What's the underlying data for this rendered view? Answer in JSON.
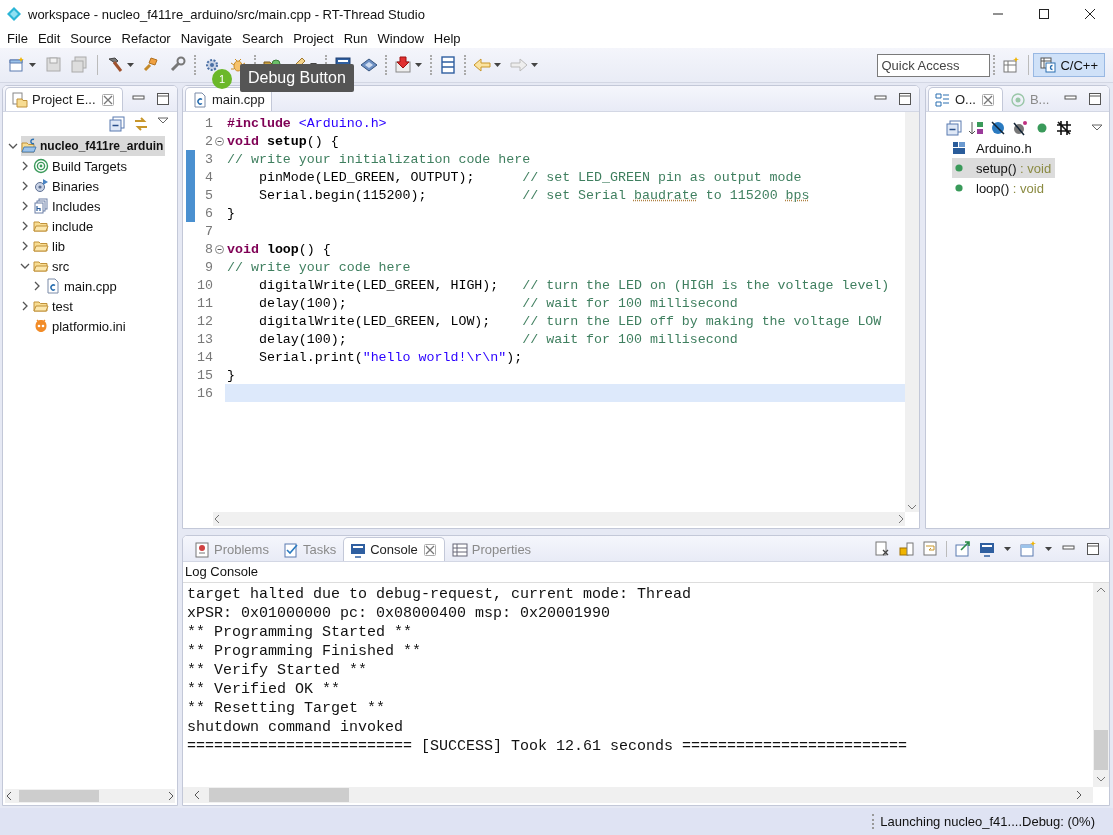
{
  "window": {
    "title": "workspace - nucleo_f411re_arduino/src/main.cpp - RT-Thread Studio"
  },
  "menu": [
    "File",
    "Edit",
    "Source",
    "Refactor",
    "Navigate",
    "Search",
    "Project",
    "Run",
    "Window",
    "Help"
  ],
  "toolbar": {
    "tooltip": {
      "badge": "1",
      "text": "Debug Button"
    },
    "quick_access": {
      "placeholder": "Quick Access"
    },
    "perspective": {
      "label": "C/C++",
      "selected": true
    }
  },
  "project_explorer": {
    "tabs": [
      {
        "label": "Project E...",
        "selected": true
      }
    ],
    "tree": [
      {
        "label": "nucleo_f411re_arduin",
        "kind": "project",
        "expanded": true,
        "selected": true,
        "children": [
          {
            "label": "Build Targets",
            "kind": "targets",
            "expanded": false,
            "selected": false
          },
          {
            "label": "Binaries",
            "kind": "binaries",
            "expanded": false,
            "selected": false
          },
          {
            "label": "Includes",
            "kind": "includes",
            "expanded": false,
            "selected": false
          },
          {
            "label": "include",
            "kind": "folder",
            "expanded": false,
            "selected": false
          },
          {
            "label": "lib",
            "kind": "folder",
            "expanded": false,
            "selected": false
          },
          {
            "label": "src",
            "kind": "folder",
            "expanded": true,
            "selected": false,
            "children": [
              {
                "label": "main.cpp",
                "kind": "source",
                "expanded": false,
                "selected": false
              }
            ]
          },
          {
            "label": "test",
            "kind": "folder",
            "expanded": false,
            "selected": false
          },
          {
            "label": "platformio.ini",
            "kind": "config",
            "selected": false
          }
        ]
      }
    ]
  },
  "editor": {
    "tabs": [
      {
        "label": "main.cpp",
        "selected": true
      }
    ],
    "lines": [
      {
        "number": "1",
        "changed": false,
        "current": false,
        "foldable": false,
        "segments": [
          {
            "kind": "preprocessor",
            "text": "#include "
          },
          {
            "kind": "string",
            "text": "<Arduino.h>"
          }
        ]
      },
      {
        "number": "2",
        "changed": false,
        "current": false,
        "foldable": true,
        "segments": [
          {
            "kind": "keyword",
            "text": "void "
          },
          {
            "kind": "function",
            "text": "setup"
          },
          {
            "kind": "plain",
            "text": "() {"
          }
        ]
      },
      {
        "number": "3",
        "changed": true,
        "current": false,
        "foldable": false,
        "segments": [
          {
            "kind": "comment",
            "text": "// write your initialization code here"
          }
        ]
      },
      {
        "number": "4",
        "changed": true,
        "current": false,
        "foldable": false,
        "segments": [
          {
            "kind": "plain",
            "text": "    pinMode(LED_GREEN, OUTPUT);      "
          },
          {
            "kind": "comment",
            "text": "// set LED_GREEN pin as output mode"
          }
        ]
      },
      {
        "number": "5",
        "changed": true,
        "current": false,
        "foldable": false,
        "segments": [
          {
            "kind": "plain",
            "text": "    Serial.begin(115200);            "
          },
          {
            "kind": "comment",
            "text": "// set Serial "
          },
          {
            "kind": "misspelled",
            "text": "baudrate"
          },
          {
            "kind": "comment",
            "text": " to 115200 "
          },
          {
            "kind": "misspelled",
            "text": "bps"
          }
        ]
      },
      {
        "number": "6",
        "changed": true,
        "current": false,
        "foldable": false,
        "segments": [
          {
            "kind": "plain",
            "text": "}"
          }
        ]
      },
      {
        "number": "7",
        "changed": false,
        "current": false,
        "foldable": false
      },
      {
        "number": "8",
        "changed": false,
        "current": false,
        "foldable": true,
        "segments": [
          {
            "kind": "keyword",
            "text": "void "
          },
          {
            "kind": "function",
            "text": "loop"
          },
          {
            "kind": "plain",
            "text": "() {"
          }
        ]
      },
      {
        "number": "9",
        "changed": false,
        "current": false,
        "foldable": false,
        "segments": [
          {
            "kind": "comment",
            "text": "// write your code here"
          }
        ]
      },
      {
        "number": "10",
        "changed": false,
        "current": false,
        "foldable": false,
        "segments": [
          {
            "kind": "plain",
            "text": "    digitalWrite(LED_GREEN, HIGH);   "
          },
          {
            "kind": "comment",
            "text": "// turn the LED on (HIGH is the voltage level)"
          }
        ]
      },
      {
        "number": "11",
        "changed": false,
        "current": false,
        "foldable": false,
        "segments": [
          {
            "kind": "plain",
            "text": "    delay(100);                      "
          },
          {
            "kind": "comment",
            "text": "// wait for 100 millisecond"
          }
        ]
      },
      {
        "number": "12",
        "changed": false,
        "current": false,
        "foldable": false,
        "segments": [
          {
            "kind": "plain",
            "text": "    digitalWrite(LED_GREEN, LOW);    "
          },
          {
            "kind": "comment",
            "text": "// turn the LED off by making the voltage LOW"
          }
        ]
      },
      {
        "number": "13",
        "changed": false,
        "current": false,
        "foldable": false,
        "segments": [
          {
            "kind": "plain",
            "text": "    delay(100);                      "
          },
          {
            "kind": "comment",
            "text": "// wait for 100 millisecond"
          }
        ]
      },
      {
        "number": "14",
        "changed": false,
        "current": false,
        "foldable": false,
        "segments": [
          {
            "kind": "plain",
            "text": "    Serial.print("
          },
          {
            "kind": "string",
            "text": "\"hello world!\\r\\n\""
          },
          {
            "kind": "plain",
            "text": ");"
          }
        ]
      },
      {
        "number": "15",
        "changed": false,
        "current": false,
        "foldable": false,
        "segments": [
          {
            "kind": "plain",
            "text": "}"
          }
        ]
      },
      {
        "number": "16",
        "changed": false,
        "current": true,
        "foldable": false
      }
    ]
  },
  "outline": {
    "tabs": [
      {
        "label": "O...",
        "selected": true
      },
      {
        "label": "B...",
        "selected": false
      }
    ],
    "items": [
      {
        "label": "Arduino.h",
        "kind": "include",
        "selected": false
      },
      {
        "label": "setup()",
        "type": " : void",
        "kind": "function",
        "selected": true
      },
      {
        "label": "loop()",
        "type": " : void",
        "kind": "function",
        "selected": false
      }
    ]
  },
  "console": {
    "tabs": [
      {
        "label": "Problems",
        "kind": "problems",
        "selected": false
      },
      {
        "label": "Tasks",
        "kind": "tasks",
        "selected": false
      },
      {
        "label": "Console",
        "kind": "console",
        "selected": true
      },
      {
        "label": "Properties",
        "kind": "properties",
        "selected": false
      }
    ],
    "title": "Log Console",
    "lines": [
      "target halted due to debug-request, current mode: Thread",
      "xPSR: 0x01000000 pc: 0x08000400 msp: 0x20001990",
      "** Programming Started **",
      "** Programming Finished **",
      "** Verify Started **",
      "** Verified OK **",
      "** Resetting Target **",
      "shutdown command invoked",
      "========================= [SUCCESS] Took 12.61 seconds ========================="
    ]
  },
  "status_bar": {
    "text": "Launching nucleo_f41....Debug: (0%)"
  }
}
